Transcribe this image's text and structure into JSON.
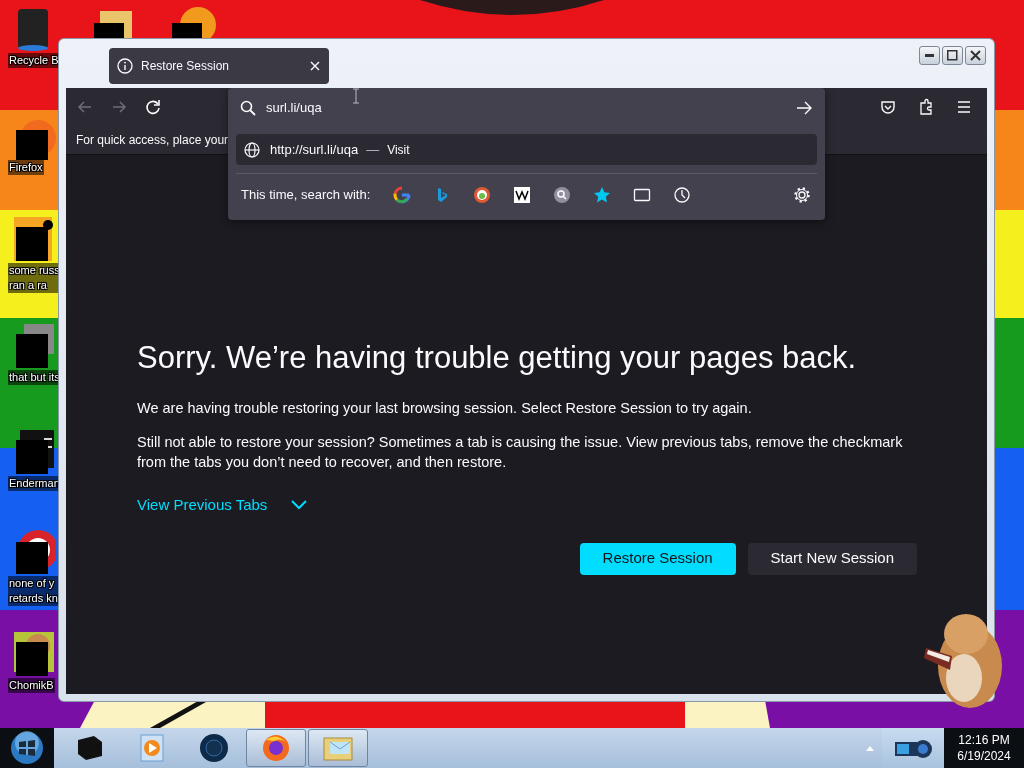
{
  "desktop": {
    "icons": [
      {
        "kind": "recycle-bin",
        "label_lines": [
          "Recycle B"
        ]
      },
      {
        "kind": "folder"
      },
      {
        "kind": "disc"
      },
      {
        "kind": "firefox",
        "label_lines": [
          "Firefox"
        ]
      },
      {
        "kind": "document",
        "label_lines": [
          "some russ",
          "ran a ra"
        ]
      },
      {
        "kind": "windows",
        "label_lines": [
          "that but its"
        ]
      },
      {
        "kind": "terminal",
        "label_lines": [
          "Enderman"
        ]
      },
      {
        "kind": "opera",
        "label_lines": [
          "none of y",
          "retards kn"
        ]
      },
      {
        "kind": "hamster",
        "label_lines": [
          "ChomikB"
        ]
      }
    ]
  },
  "browser": {
    "tab": {
      "title": "Restore Session",
      "selected": true
    },
    "nav": [
      {
        "kind": "back",
        "disabled": true
      },
      {
        "kind": "forward",
        "disabled": true
      },
      {
        "kind": "reload",
        "disabled": false
      }
    ],
    "bookmarks_hint": "For quick access, place your",
    "urlbar": {
      "value": "surl.li/uqa",
      "result": {
        "url": "http://surl.li/uqa",
        "separator": "—",
        "action": "Visit",
        "selected": true
      },
      "search_with_label": "This time, search with:",
      "engines": [
        {
          "kind": "google"
        },
        {
          "kind": "bing"
        },
        {
          "kind": "duckduckgo"
        },
        {
          "kind": "wikipedia"
        },
        {
          "kind": "search"
        },
        {
          "kind": "bookmarks"
        },
        {
          "kind": "tabs"
        },
        {
          "kind": "history"
        }
      ]
    },
    "toolbar_right": [
      {
        "kind": "pocket"
      },
      {
        "kind": "extensions"
      },
      {
        "kind": "menu"
      }
    ],
    "page": {
      "heading": "Sorry. We’re having trouble getting your pages back.",
      "paragraphs": [
        "We are having trouble restoring your last browsing session. Select Restore Session to try again.",
        "Still not able to restore your session? Sometimes a tab is causing the issue. View previous tabs, remove the checkmark from the tabs you don’t need to recover, and then restore."
      ],
      "toggle": {
        "label": "View Previous Tabs",
        "expanded": false
      },
      "buttons": [
        {
          "label": "Restore Session",
          "kind": "primary"
        },
        {
          "label": "Start New Session",
          "kind": "secondary"
        }
      ]
    }
  },
  "taskbar": {
    "apps": [
      {
        "kind": "box",
        "active": false
      },
      {
        "kind": "media-player",
        "active": false
      },
      {
        "kind": "orb",
        "active": false
      },
      {
        "kind": "firefox",
        "active": true
      },
      {
        "kind": "mail",
        "active": true
      }
    ],
    "clock": {
      "time": "12:16 PM",
      "date": "6/19/2024"
    }
  }
}
